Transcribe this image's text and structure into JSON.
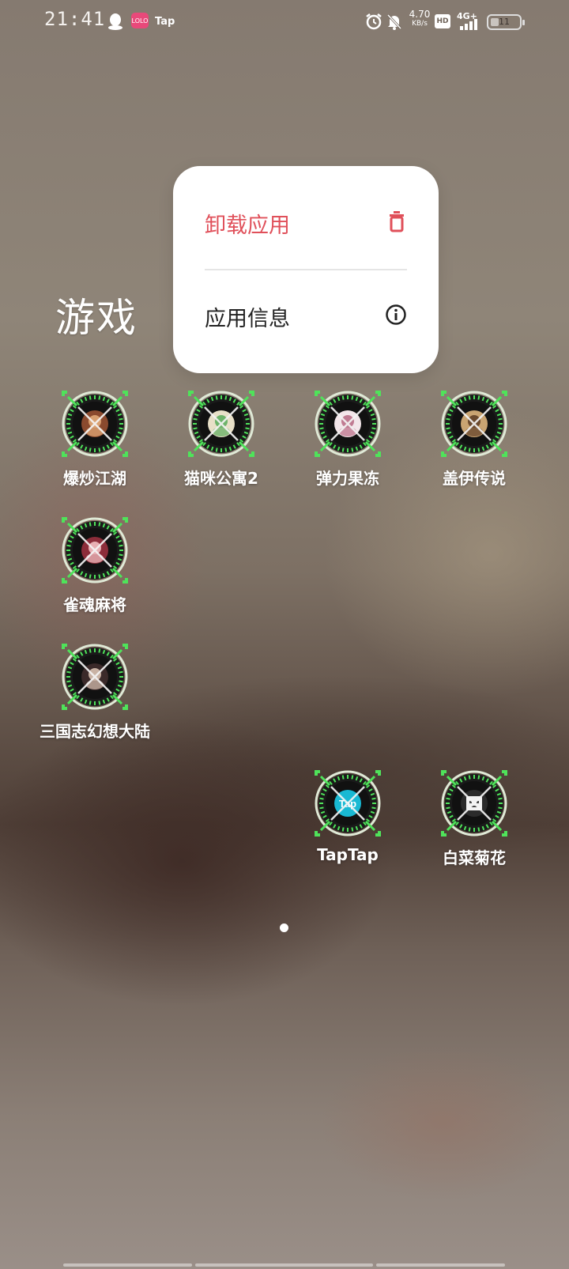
{
  "status_bar": {
    "time": "21:41",
    "notif_icons": [
      "qq-icon",
      "app-badge-icon",
      "taptap-icon"
    ],
    "app_badge_text": "LOLO",
    "tap_label": "Tap",
    "net_speed": "4.70",
    "net_unit": "KB/s",
    "hd_label": "HD",
    "network": "4G+",
    "battery_level": "11"
  },
  "popup": {
    "uninstall_label": "卸载应用",
    "info_label": "应用信息"
  },
  "folder": {
    "title": "游戏",
    "apps": [
      {
        "name": "爆炒江湖"
      },
      {
        "name": "猫咪公寓2"
      },
      {
        "name": "弹力果冻"
      },
      {
        "name": "盖伊传说"
      },
      {
        "name": "雀魂麻将"
      },
      {
        "name": "三国志幻想大陆"
      },
      {
        "name": "TapTap",
        "center_text": "Tap"
      },
      {
        "name": "白菜菊花"
      }
    ]
  },
  "colors": {
    "danger": "#e0505a",
    "ring_green": "#4fe35a"
  }
}
